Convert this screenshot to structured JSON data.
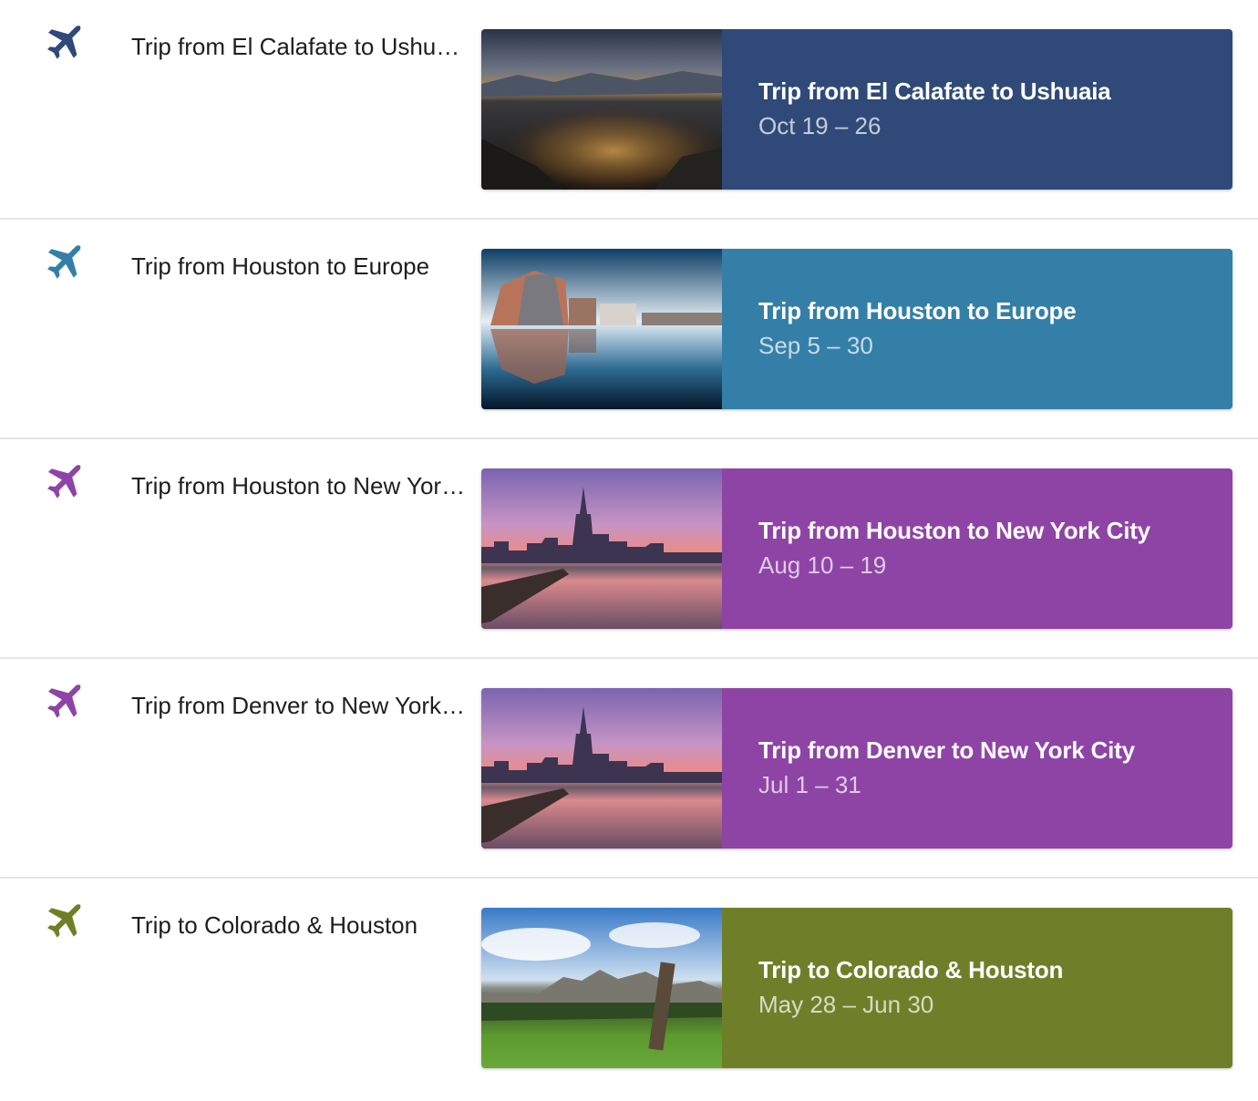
{
  "trips": [
    {
      "row_title": "Trip from El Calafate to Ushuaia",
      "card_title": "Trip from El Calafate to Ushuaia",
      "dates": "Oct 19 – 26",
      "color": "#2f4a78",
      "icon_color": "#2f4a78",
      "icon": "airplane-icon",
      "image": "night-city-photo"
    },
    {
      "row_title": "Trip from Houston to Europe",
      "card_title": "Trip from Houston to Europe",
      "dates": "Sep 5 – 30",
      "color": "#347fa8",
      "icon_color": "#347fa8",
      "icon": "airplane-icon",
      "image": "waterfront-city-photo"
    },
    {
      "row_title": "Trip from Houston to New York City",
      "card_title": "Trip from Houston to New York City",
      "dates": "Aug 10 – 19",
      "color": "#8e44a5",
      "icon_color": "#8e44a5",
      "icon": "airplane-icon",
      "image": "new-york-skyline-photo"
    },
    {
      "row_title": "Trip from Denver to New York City",
      "card_title": "Trip from Denver to New York City",
      "dates": "Jul 1 – 31",
      "color": "#8e44a5",
      "icon_color": "#8e44a5",
      "icon": "airplane-icon",
      "image": "new-york-skyline-photo"
    },
    {
      "row_title": "Trip to Colorado & Houston",
      "card_title": "Trip to Colorado & Houston",
      "dates": "May 28 – Jun 30",
      "color": "#6f7f29",
      "icon_color": "#6f7f29",
      "icon": "airplane-icon",
      "image": "mountain-meadow-photo"
    }
  ]
}
